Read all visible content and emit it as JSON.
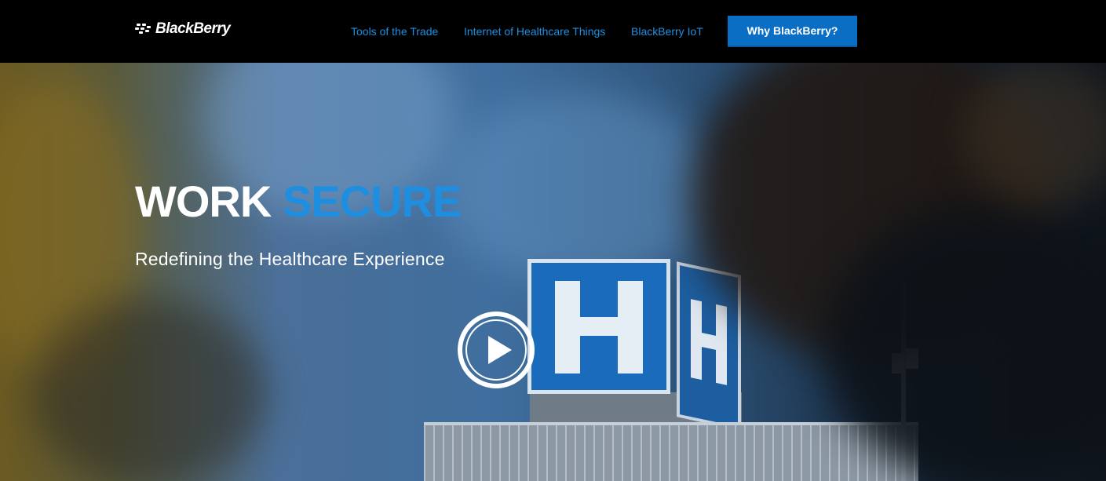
{
  "header": {
    "logo_text": "BlackBerry",
    "nav": [
      {
        "label": "Tools of the Trade"
      },
      {
        "label": "Internet of Healthcare Things"
      },
      {
        "label": "BlackBerry IoT"
      }
    ],
    "cta_label": "Why BlackBerry?"
  },
  "hero": {
    "headline_white": "WORK",
    "headline_blue": "SECURE",
    "subheadline": "Redefining the Healthcare Experience",
    "play_icon": "play-circle-icon"
  },
  "colors": {
    "accent": "#1e8fe0",
    "cta_background": "#0a6fc4",
    "header_background": "#000000"
  }
}
